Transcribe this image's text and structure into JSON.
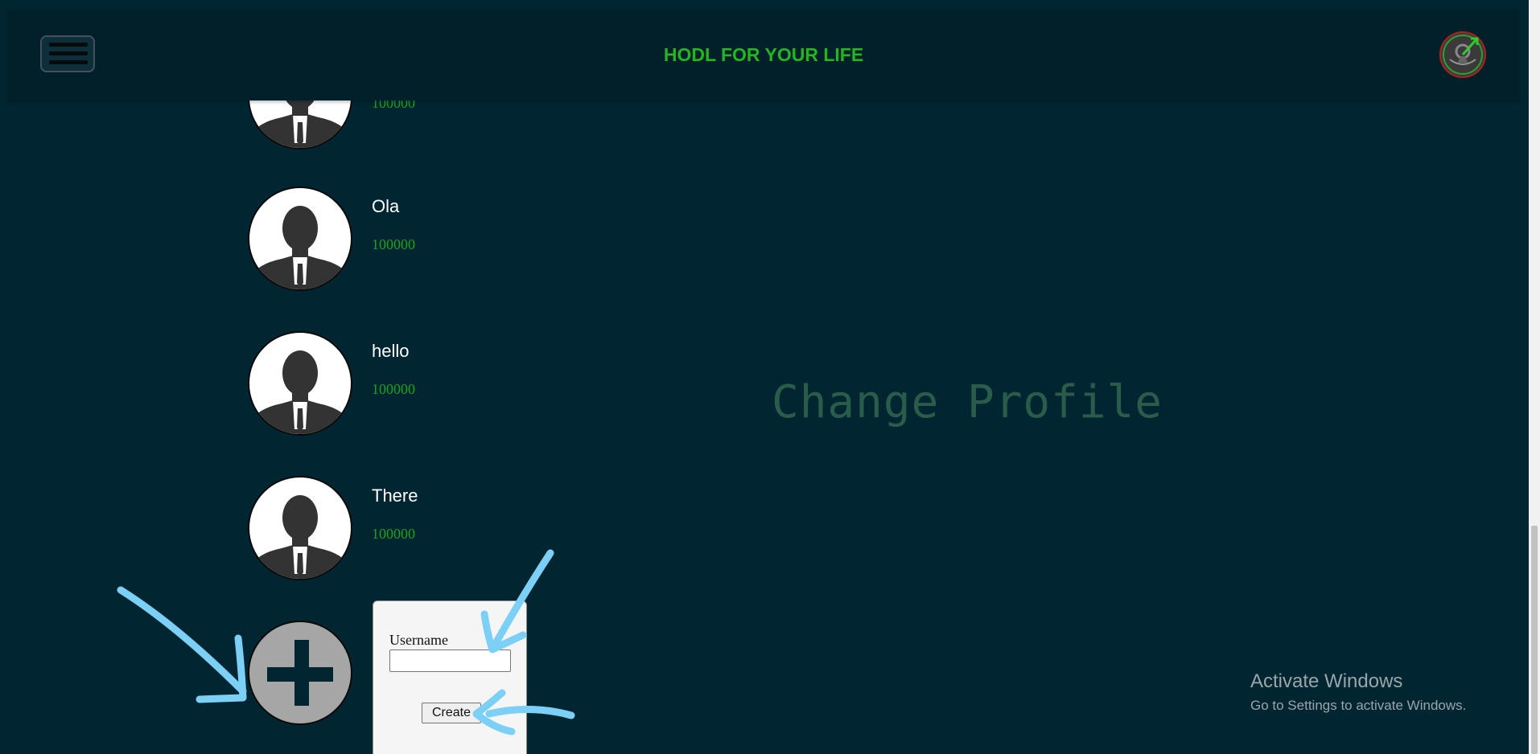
{
  "header": {
    "title": "HODL FOR YOUR LIFE",
    "menu_icon": "hamburger-menu-icon",
    "logo_icon": "app-logo-icon"
  },
  "profiles": [
    {
      "name": "",
      "balance": "100000"
    },
    {
      "name": "Ola",
      "balance": "100000"
    },
    {
      "name": "hello",
      "balance": "100000"
    },
    {
      "name": "There",
      "balance": "100000"
    }
  ],
  "add_profile": {
    "icon": "plus-icon",
    "username_label": "Username",
    "username_value": "",
    "create_label": "Create"
  },
  "main": {
    "heading": "Change Profile"
  },
  "watermark": {
    "title": "Activate Windows",
    "subtitle": "Go to Settings to activate Windows."
  },
  "colors": {
    "background": "#012632",
    "header_bg": "#01202a",
    "title_green": "#25b523",
    "balance_green": "#1fa01c",
    "heading_muted": "#2a5c4a",
    "annotation_arrow": "#7dd0f5"
  }
}
